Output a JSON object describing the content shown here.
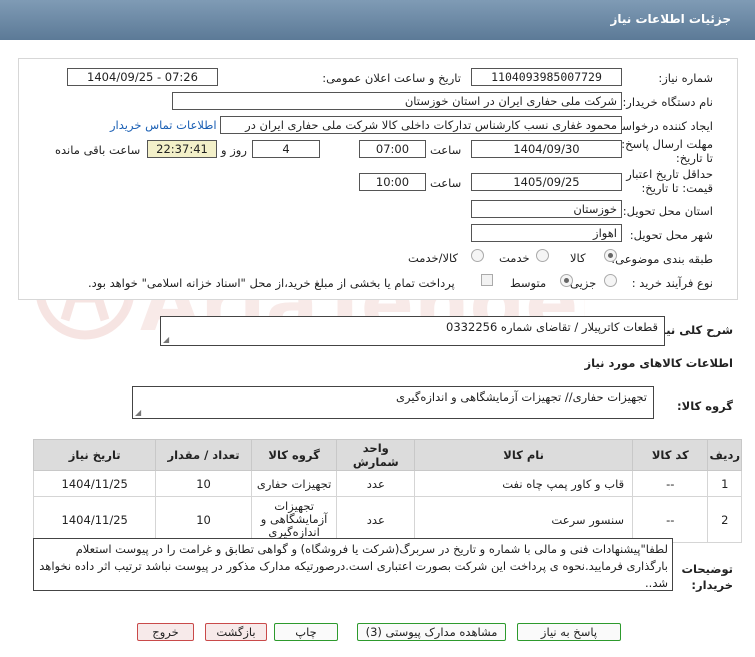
{
  "header": {
    "title": "جزئیات اطلاعات نیاز"
  },
  "form": {
    "need_number_label": "شماره نیاز:",
    "need_number": "1104093985007729",
    "announce_label": "تاریخ و ساعت اعلان عمومی:",
    "announce_value": "1404/09/25 - 07:26",
    "buyer_org_label": "نام دستگاه خریدار:",
    "buyer_org": "شرکت ملی حفاری ایران در استان خوزستان",
    "creator_label": "ایجاد کننده درخواست:",
    "creator": "محمود غفاری نسب کارشناس تدارکات داخلی  کالا شرکت ملی حفاری ایران در",
    "contact_link": "اطلاعات تماس خریدار",
    "reply_deadline_label": "مهلت ارسال پاسخ: تا تاریخ:",
    "reply_date": "1404/09/30",
    "time_label": "ساعت",
    "reply_time": "07:00",
    "days_value": "4",
    "days_label": "روز و",
    "remaining_time": "22:37:41",
    "remaining_label": "ساعت باقی مانده",
    "validity_label": "حداقل تاریخ اعتبار قیمت: تا تاریخ:",
    "validity_date": "1405/09/25",
    "validity_time": "10:00",
    "province_label": "استان محل تحویل:",
    "province": "خوزستان",
    "city_label": "شهر محل تحویل:",
    "city": "اهواز",
    "category_label": "طبقه بندی موضوعی:",
    "category_options": [
      "کالا",
      "خدمت",
      "کالا/خدمت"
    ],
    "process_label": "نوع فرآیند خرید :",
    "process_options": [
      "جزیی",
      "متوسط"
    ],
    "payment_note": "پرداخت تمام یا بخشی از مبلغ خرید،از محل \"اسناد خزانه اسلامی\" خواهد بود."
  },
  "summary": {
    "label": "شرح کلی نیاز:",
    "text": "قطعات  کاترپیلار /  تقاضای شماره   0332256"
  },
  "goods_info": {
    "title": "اطلاعات کالاهای مورد نیاز",
    "group_label": "گروه کالا:",
    "group_text": "تجهیزات حفاری// تجهیزات آزمایشگاهی و اندازه‌گیری"
  },
  "table": {
    "headers": [
      "ردیف",
      "کد کالا",
      "نام کالا",
      "واحد شمارش",
      "گروه کالا",
      "تعداد / مقدار",
      "تاریخ نیاز"
    ],
    "rows": [
      {
        "index": "1",
        "code": "--",
        "name": "قاب و کاور پمپ چاه نفت",
        "unit": "عدد",
        "group": "تجهیزات حفاری",
        "qty": "10",
        "date": "1404/11/25"
      },
      {
        "index": "2",
        "code": "--",
        "name": "سنسور سرعت",
        "unit": "عدد",
        "group": "تجهیزات آزمایشگاهی و اندازه‌گیری",
        "qty": "10",
        "date": "1404/11/25"
      }
    ]
  },
  "buyer_notes": {
    "label": "توضیحات خریدار:",
    "text": "لطفا\"پیشنهادات فنی و مالی با شماره و تاریخ در سربرگ(شرکت یا فروشگاه) و گواهی تطابق و غرامت را در پیوست استعلام بارگذاری فرمایید.نحوه ی پرداخت این شرکت بصورت اعتباری است.درصورتیکه مدارک مذکور در پیوست نباشد ترتیب اثر داده نخواهد شد.."
  },
  "buttons": {
    "reply": "پاسخ به نیاز",
    "attachments": "مشاهده مدارک پیوستی (3)",
    "print": "چاپ",
    "back": "بازگشت",
    "exit": "خروج"
  },
  "watermark": {
    "text": "AriaTender.net"
  },
  "colors": {
    "title_bar": "#6d8aa6",
    "link": "#1a5fb4",
    "button_border": "#2d9a2d",
    "remaining_bg": "#f3f0c9"
  }
}
